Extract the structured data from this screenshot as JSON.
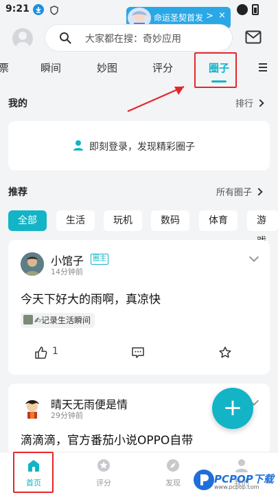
{
  "status_bar": {
    "time": "9:21"
  },
  "notification": {
    "text": "命运圣契首发",
    "arrow": ">",
    "close": "×"
  },
  "search": {
    "placeholder": "大家都在搜：奇妙应用"
  },
  "tabs": [
    {
      "label": "票"
    },
    {
      "label": "瞬间"
    },
    {
      "label": "妙图"
    },
    {
      "label": "评分"
    },
    {
      "label": "圈子",
      "active": true
    }
  ],
  "mine": {
    "title": "我的",
    "link": "排行",
    "login_text": "即刻登录，发现精彩圈子"
  },
  "recommend": {
    "title": "推荐",
    "link": "所有圈子",
    "chips": [
      "全部",
      "生活",
      "玩机",
      "数码",
      "体育",
      "游戏"
    ]
  },
  "posts": [
    {
      "author": "小馆子",
      "badge": "圈主",
      "time": "14分钟前",
      "text": "今天下好大的雨啊，真凉快",
      "tag": "✍记录生活瞬间",
      "likes": "1"
    },
    {
      "author": "晴天无雨便是情",
      "time": "29分钟前",
      "text": "滴滴滴，官方番茄小说OPPO自带"
    }
  ],
  "fab": {
    "label": "+"
  },
  "bottom_nav": [
    {
      "label": "首页",
      "icon": "home-icon",
      "active": true
    },
    {
      "label": "评分",
      "icon": "star-icon"
    },
    {
      "label": "发现",
      "icon": "compass-icon"
    },
    {
      "label": "我的",
      "icon": "user-icon"
    }
  ],
  "watermark": {
    "brand": "PCPOP下载",
    "url": "www.pcpop.com"
  },
  "colors": {
    "accent": "#12b4c6",
    "highlight": "#e3262a"
  }
}
